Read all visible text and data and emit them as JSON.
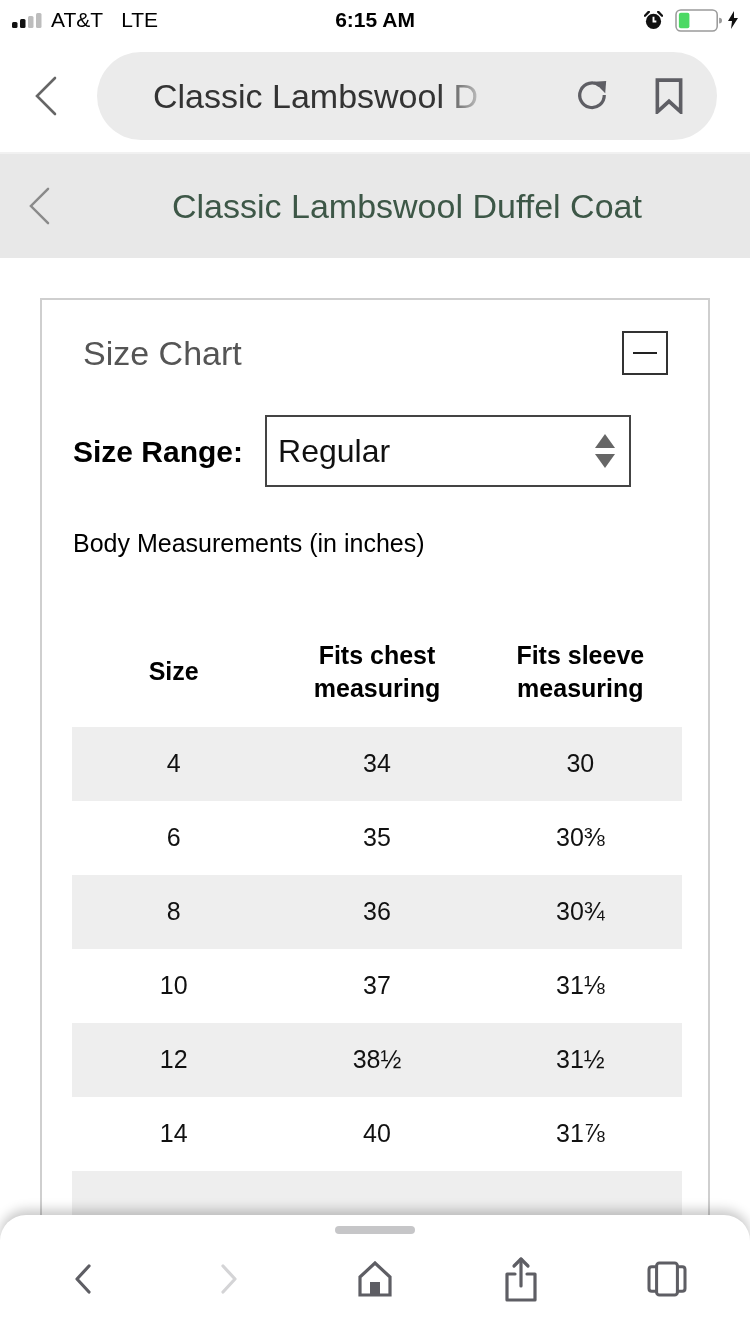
{
  "status_bar": {
    "carrier": "AT&T",
    "network": "LTE",
    "time": "6:15 AM"
  },
  "address_bar": {
    "title": "Classic Lambswool D"
  },
  "page_header": {
    "title": "Classic Lambswool Duffel Coat"
  },
  "size_chart": {
    "title": "Size Chart",
    "expanded": true,
    "size_range": {
      "label": "Size Range:",
      "value": "Regular"
    },
    "note": "Body Measurements (in inches)",
    "table": {
      "columns": [
        "Size",
        "Fits chest measuring",
        "Fits sleeve measuring"
      ],
      "rows": [
        [
          "4",
          "34",
          "30"
        ],
        [
          "6",
          "35",
          "30⅜"
        ],
        [
          "8",
          "36",
          "30¾"
        ],
        [
          "10",
          "37",
          "31⅛"
        ],
        [
          "12",
          "38½",
          "31½"
        ],
        [
          "14",
          "40",
          "31⅞"
        ]
      ]
    }
  },
  "bottom_toolbar": {
    "buttons": [
      {
        "kind": "back",
        "disabled": false
      },
      {
        "kind": "forward",
        "disabled": true
      },
      {
        "kind": "home",
        "disabled": false
      },
      {
        "kind": "share",
        "disabled": false
      },
      {
        "kind": "tabs",
        "disabled": false
      }
    ]
  }
}
